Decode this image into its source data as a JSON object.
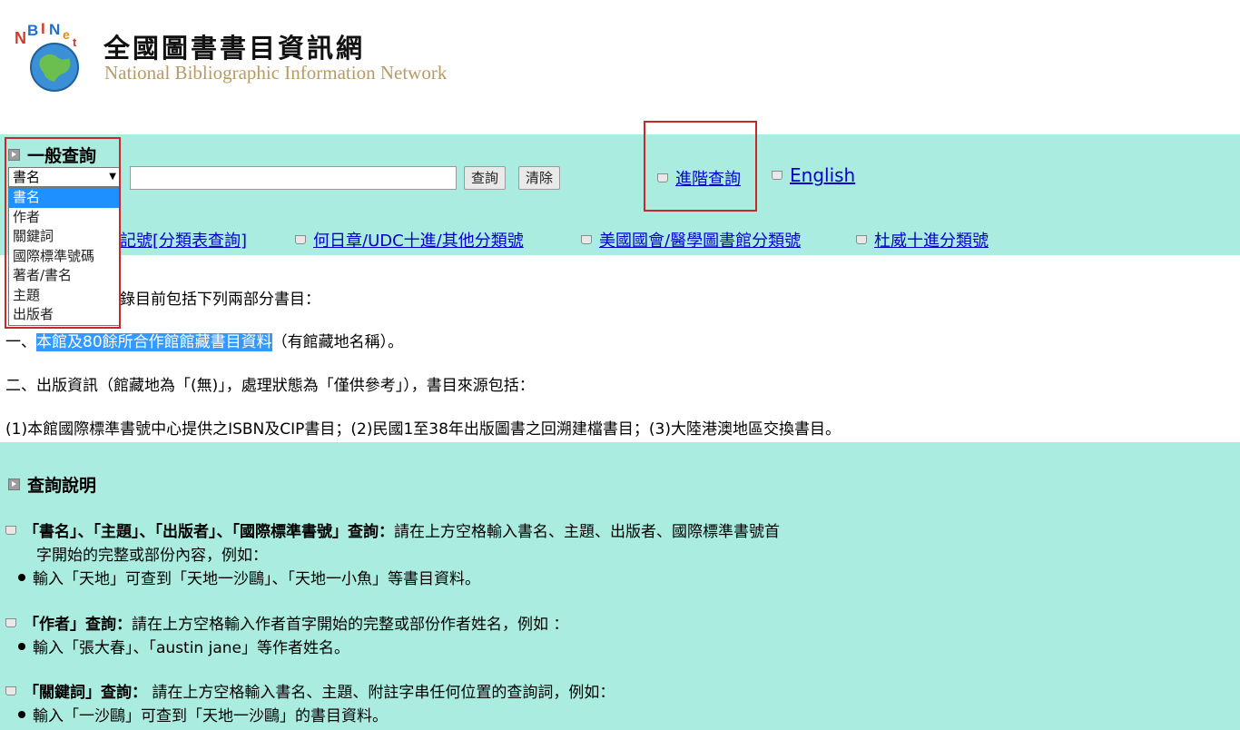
{
  "header": {
    "logo_text": "NBINet",
    "title_zh": "全國圖書書目資訊網",
    "title_en": "National Bibliographic Information Network"
  },
  "search": {
    "section_title": "一般查詢",
    "field_selected": "書名",
    "field_options": [
      "書名",
      "作者",
      "關鍵詞",
      "國際標準號碼",
      "著者/書名",
      "主題",
      "出版者"
    ],
    "input_value": "",
    "query_button": "查詢",
    "clear_button": "清除",
    "advanced_link": "進階查詢",
    "english_link": "English"
  },
  "class_links": {
    "partial_link": "記號[分類表查詢]",
    "link2": "何日章/UDC十進/其他分類號",
    "link3": "美國國會/醫學圖書館分類號",
    "link4": "杜威十進分類號"
  },
  "intro": {
    "line0": "錄目前包括下列兩部分書目：",
    "line1_prefix": "一、",
    "line1_highlight": "本館及80餘所合作館館藏書目資料",
    "line1_suffix": "（有館藏地名稱）。",
    "line2": "二、出版資訊（館藏地為「(無)」，處理狀態為「僅供參考」），書目來源包括：",
    "line3": "(1)本館國際標準書號中心提供之ISBN及CIP書目；(2)民國1至38年出版圖書之回溯建檔書目；(3)大陸港澳地區交換書目。"
  },
  "help": {
    "title": "查詢說明",
    "item1_bold": "「書名」、「主題」、「出版者」、「國際標準書號」查詢：",
    "item1_text": "請在上方空格輸入書名、主題、出版者、國際標準書號首",
    "item1_text2": "字開始的完整或部份內容，例如：",
    "item1_bullet": "輸入「天地」可查到「天地一沙鷗」、「天地一小魚」等書目資料。",
    "item2_bold": "「作者」查詢：",
    "item2_text": "請在上方空格輸入作者首字開始的完整或部份作者姓名，例如 ：",
    "item2_bullet": "輸入「張大春」、「austin jane」等作者姓名。",
    "item3_bold": "「關鍵詞」查詢：",
    "item3_text": " 請在上方空格輸入書名、主題、附註字串任何位置的查詢詞，例如：",
    "item3_bullet": "輸入「一沙鷗」可查到「天地一沙鷗」的書目資料。"
  },
  "colors": {
    "band": "#aaede0",
    "link": "#0000cc",
    "highlight": "#3399ff",
    "annotation_red": "#c8282c"
  }
}
